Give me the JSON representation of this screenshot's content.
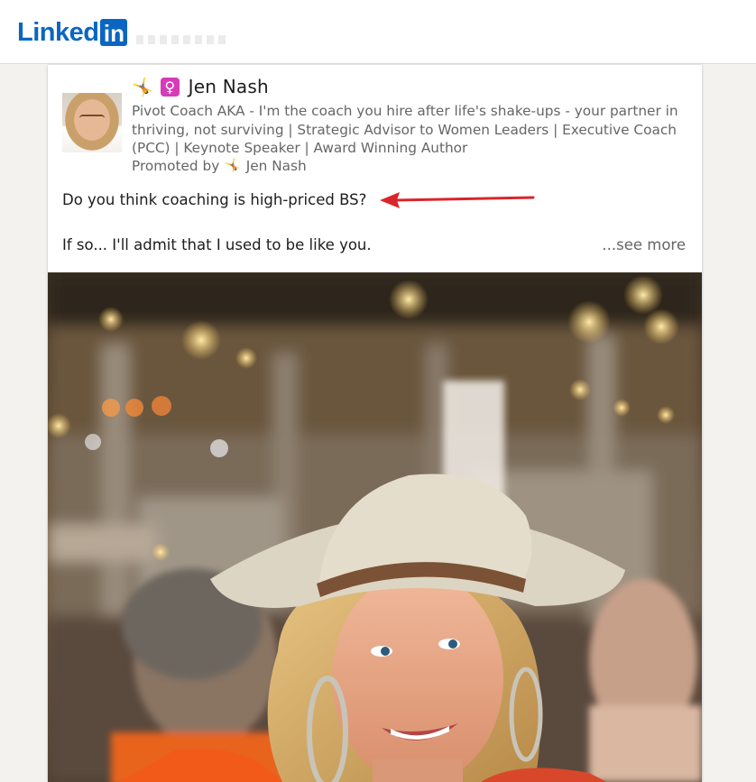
{
  "header": {
    "logo_text": "Linked",
    "logo_box_text": "in"
  },
  "post": {
    "author": {
      "name": "Jen Nash",
      "headline": "Pivot Coach AKA - I'm the coach you hire after life's shake-ups - your partner in thriving, not surviving | Strategic Advisor to Women Leaders | Executive Coach (PCC) | Keynote Speaker | Award Winning Author",
      "promoted_label": "Promoted by",
      "promoted_name": "Jen Nash"
    },
    "emoji_icon_1": "🤸",
    "emoji_icon_2": "♀",
    "text_line1": "Do you think coaching is high-priced BS?",
    "text_line2": "If so... I'll admit that I used to be like you.",
    "see_more": "...see more"
  },
  "colors": {
    "brand": "#0a66c2",
    "arrow": "#d9262b",
    "secondary_text": "#666666"
  },
  "icons": {
    "logo": "linkedin-logo",
    "annotation": "red-arrow-icon"
  }
}
